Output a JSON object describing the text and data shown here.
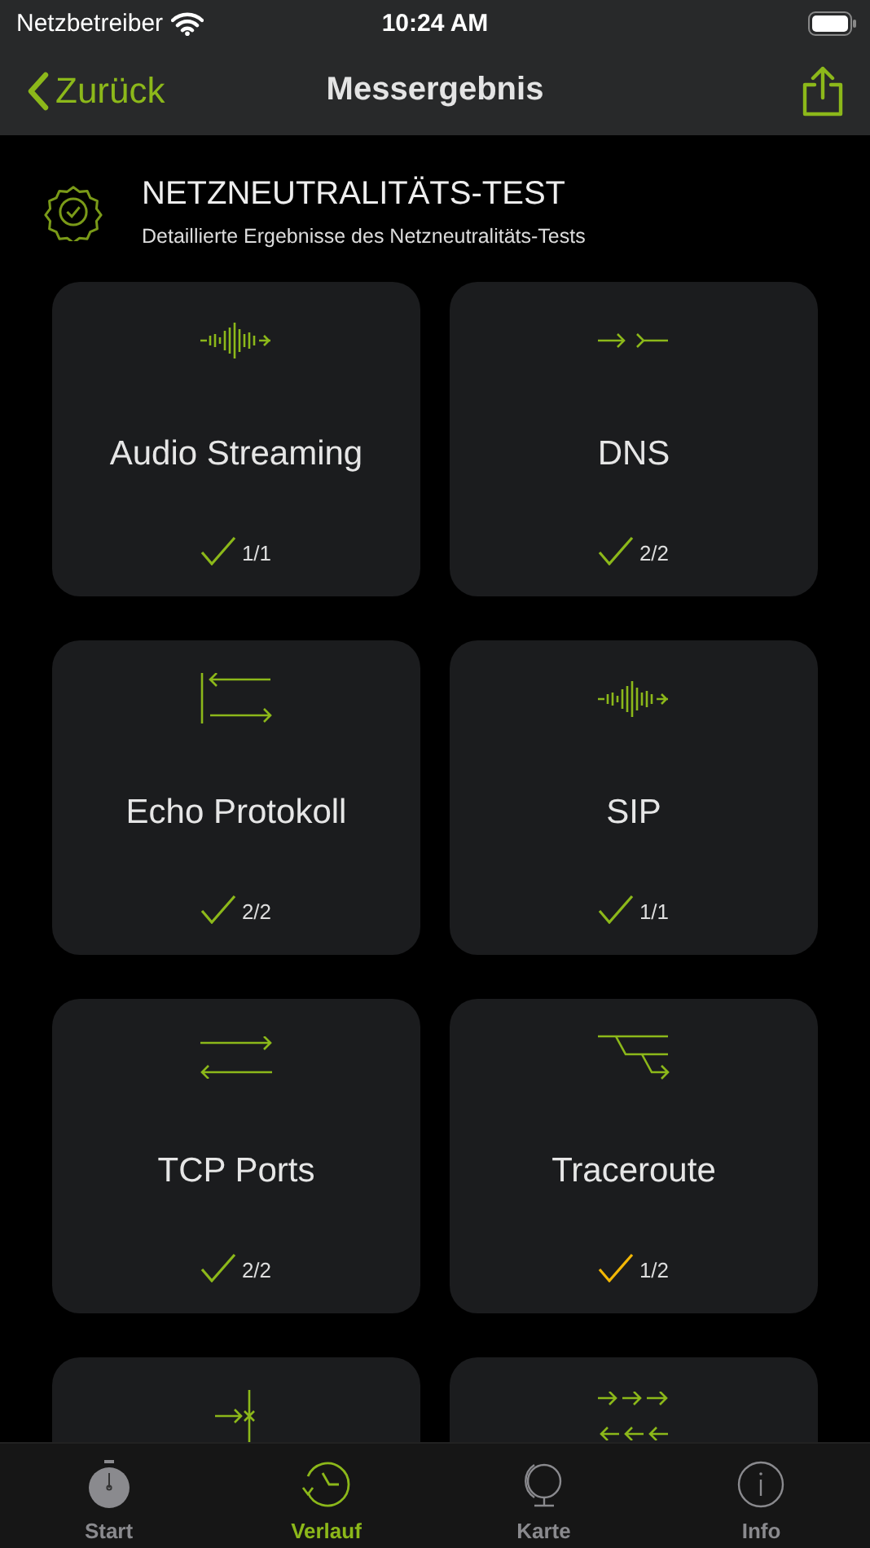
{
  "status_bar": {
    "carrier": "Netzbetreiber",
    "time": "10:24 AM"
  },
  "nav": {
    "back": "Zurück",
    "title": "Messergebnis"
  },
  "header": {
    "title": "NETZNEUTRALITÄTS-TEST",
    "subtitle": "Detaillierte Ergebnisse des Netzneutralitäts-Tests"
  },
  "tests": [
    {
      "kind": "waveform",
      "title": "Audio Streaming",
      "color": "#8cb81a",
      "result": "1/1"
    },
    {
      "kind": "dns",
      "title": "DNS",
      "color": "#8cb81a",
      "result": "2/2"
    },
    {
      "kind": "echo",
      "title": "Echo Protokoll",
      "color": "#8cb81a",
      "result": "2/2"
    },
    {
      "kind": "waveform",
      "title": "SIP",
      "color": "#8cb81a",
      "result": "1/1"
    },
    {
      "kind": "tcp",
      "title": "TCP Ports",
      "color": "#8cb81a",
      "result": "2/2"
    },
    {
      "kind": "traceroute",
      "title": "Traceroute",
      "color": "#f2b705",
      "result": "1/2"
    },
    {
      "kind": "blocked"
    },
    {
      "kind": "multi"
    }
  ],
  "tabs": [
    {
      "kind": "stopwatch",
      "label": "Start",
      "selected": false
    },
    {
      "kind": "history",
      "label": "Verlauf",
      "selected": true
    },
    {
      "kind": "globe",
      "label": "Karte",
      "selected": false
    },
    {
      "kind": "info",
      "label": "Info",
      "selected": false
    }
  ]
}
